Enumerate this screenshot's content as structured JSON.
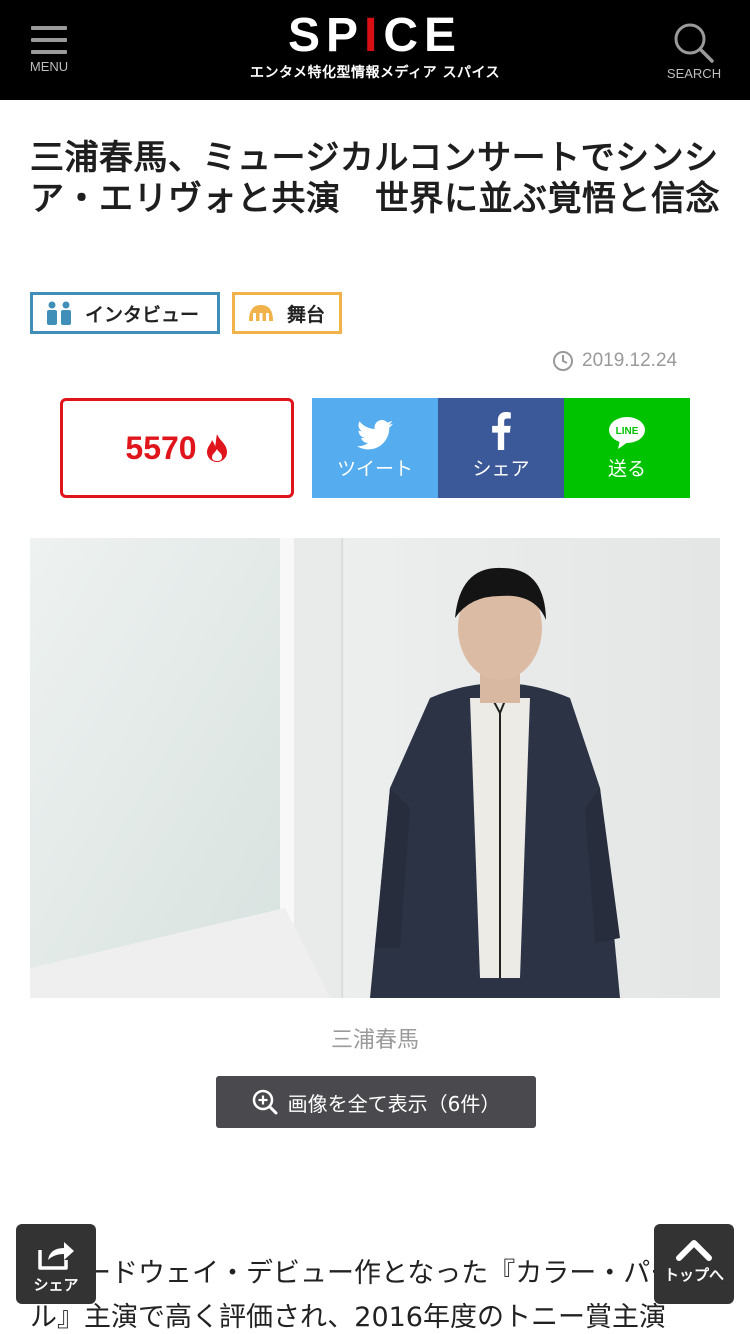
{
  "header": {
    "menu_label": "MENU",
    "logo_text_pre": "SP",
    "logo_text_chili": "I",
    "logo_text_post": "CE",
    "logo_subtitle": "エンタメ特化型情報メディア スパイス",
    "search_label": "SEARCH"
  },
  "article": {
    "title": "三浦春馬、ミュージカルコンサートでシンシア・エリヴォと共演　世界に並ぶ覚悟と信念",
    "tags": [
      {
        "label": "インタビュー",
        "icon": "interview-icon",
        "color": "#3f8fb8"
      },
      {
        "label": "舞台",
        "icon": "theater-icon",
        "color": "#f2b24a"
      }
    ],
    "date": "2019.12.24"
  },
  "share": {
    "count": "5570",
    "twitter_label": "ツイート",
    "facebook_label": "シェア",
    "line_label": "送る",
    "line_icon_text": "LINE",
    "colors": {
      "twitter": "#55acee",
      "facebook": "#3b5998",
      "line": "#00c300",
      "count": "#e0141b"
    }
  },
  "photo": {
    "caption": "三浦春馬",
    "gallery_button_label": "画像を全て表示（6件）"
  },
  "body": {
    "text": "ブロードウェイ・デビュー作となった『カラー・パープル』主演で高く評価され、2016年度のトニー賞主演"
  },
  "floating": {
    "share_label": "シェア",
    "top_label": "トップへ"
  }
}
